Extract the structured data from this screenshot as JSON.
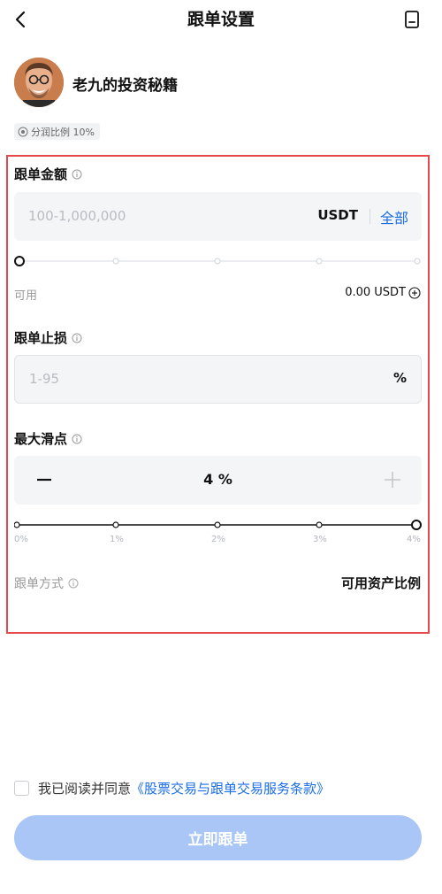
{
  "header": {
    "title": "跟单设置"
  },
  "trader": {
    "name": "老九的投资秘籍",
    "profit_share": "分润比例 10%"
  },
  "amount": {
    "label": "跟单金额",
    "placeholder": "100-1,000,000",
    "unit": "USDT",
    "all_label": "全部",
    "available_label": "可用",
    "available_value": "0.00 USDT",
    "slider_level": 0
  },
  "stop_loss": {
    "label": "跟单止损",
    "placeholder": "1-95",
    "unit": "%"
  },
  "slippage": {
    "label": "最大滑点",
    "value": "4 %",
    "slider_ticks": [
      "0%",
      "1%",
      "2%",
      "3%",
      "4%"
    ],
    "slider_level": 1.0
  },
  "copy_mode": {
    "label": "跟单方式",
    "value": "可用资产比例"
  },
  "agreement": {
    "text": "我已阅读并同意",
    "link": "《股票交易与跟单交易服务条款》"
  },
  "submit": {
    "label": "立即跟单"
  },
  "colors": {
    "accent": "#1a6ce8",
    "highlight_border": "#e5484d",
    "submit_disabled": "#a9c6f6"
  },
  "icons": [
    "back-icon",
    "book-icon",
    "info-icon",
    "plus-circle-icon",
    "minus-icon",
    "plus-icon",
    "share-icon"
  ]
}
